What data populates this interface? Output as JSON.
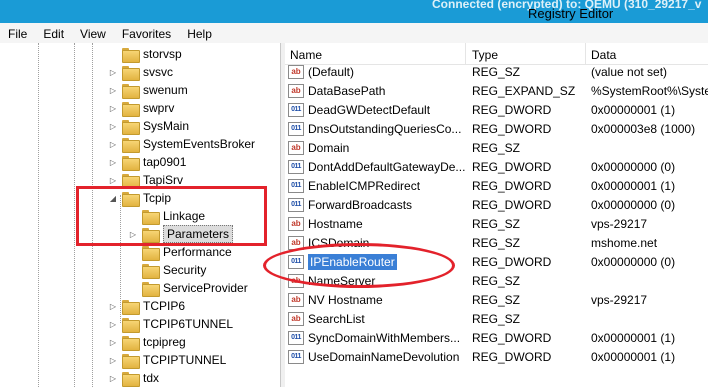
{
  "window": {
    "connection_title": "Connected (encrypted) to: QEMU (310_29217_v",
    "app_title": "Registry Editor"
  },
  "menu": [
    "File",
    "Edit",
    "View",
    "Favorites",
    "Help"
  ],
  "tree": {
    "items": [
      {
        "label": "storvsp",
        "expander": ""
      },
      {
        "label": "svsvc",
        "expander": "▷"
      },
      {
        "label": "swenum",
        "expander": "▷"
      },
      {
        "label": "swprv",
        "expander": "▷"
      },
      {
        "label": "SysMain",
        "expander": "▷"
      },
      {
        "label": "SystemEventsBroker",
        "expander": "▷"
      },
      {
        "label": "tap0901",
        "expander": "▷"
      },
      {
        "label": "TapiSrv",
        "expander": "▷"
      },
      {
        "label": "Tcpip",
        "expander": "◢"
      },
      {
        "label": "Linkage",
        "expander": ""
      },
      {
        "label": "Parameters",
        "expander": "▷"
      },
      {
        "label": "Performance",
        "expander": ""
      },
      {
        "label": "Security",
        "expander": ""
      },
      {
        "label": "ServiceProvider",
        "expander": ""
      },
      {
        "label": "TCPIP6",
        "expander": "▷"
      },
      {
        "label": "TCPIP6TUNNEL",
        "expander": "▷"
      },
      {
        "label": "tcpipreg",
        "expander": "▷"
      },
      {
        "label": "TCPIPTUNNEL",
        "expander": "▷"
      },
      {
        "label": "tdx",
        "expander": "▷"
      }
    ]
  },
  "list": {
    "columns": {
      "name": "Name",
      "type": "Type",
      "data": "Data"
    },
    "rows": [
      {
        "icon": "ab",
        "name": "(Default)",
        "type": "REG_SZ",
        "data": "(value not set)"
      },
      {
        "icon": "ab",
        "name": "DataBasePath",
        "type": "REG_EXPAND_SZ",
        "data": "%SystemRoot%\\Syste"
      },
      {
        "icon": "011",
        "name": "DeadGWDetectDefault",
        "type": "REG_DWORD",
        "data": "0x00000001 (1)"
      },
      {
        "icon": "011",
        "name": "DnsOutstandingQueriesCo...",
        "type": "REG_DWORD",
        "data": "0x000003e8 (1000)"
      },
      {
        "icon": "ab",
        "name": "Domain",
        "type": "REG_SZ",
        "data": ""
      },
      {
        "icon": "011",
        "name": "DontAddDefaultGatewayDe...",
        "type": "REG_DWORD",
        "data": "0x00000000 (0)"
      },
      {
        "icon": "011",
        "name": "EnableICMPRedirect",
        "type": "REG_DWORD",
        "data": "0x00000001 (1)"
      },
      {
        "icon": "011",
        "name": "ForwardBroadcasts",
        "type": "REG_DWORD",
        "data": "0x00000000 (0)"
      },
      {
        "icon": "ab",
        "name": "Hostname",
        "type": "REG_SZ",
        "data": "vps-29217"
      },
      {
        "icon": "ab",
        "name": "ICSDomain",
        "type": "REG_SZ",
        "data": "mshome.net"
      },
      {
        "icon": "011",
        "name": "IPEnableRouter",
        "type": "REG_DWORD",
        "data": "0x00000000 (0)"
      },
      {
        "icon": "ab",
        "name": "NameServer",
        "type": "REG_SZ",
        "data": ""
      },
      {
        "icon": "ab",
        "name": "NV Hostname",
        "type": "REG_SZ",
        "data": "vps-29217"
      },
      {
        "icon": "ab",
        "name": "SearchList",
        "type": "REG_SZ",
        "data": ""
      },
      {
        "icon": "011",
        "name": "SyncDomainWithMembers...",
        "type": "REG_DWORD",
        "data": "0x00000001 (1)"
      },
      {
        "icon": "011",
        "name": "UseDomainNameDevolution",
        "type": "REG_DWORD",
        "data": "0x00000001 (1)"
      }
    ]
  },
  "colors": {
    "titlebar": "#1a9bd6",
    "selection": "#3a7fd6",
    "highlight": "#e3222b"
  }
}
